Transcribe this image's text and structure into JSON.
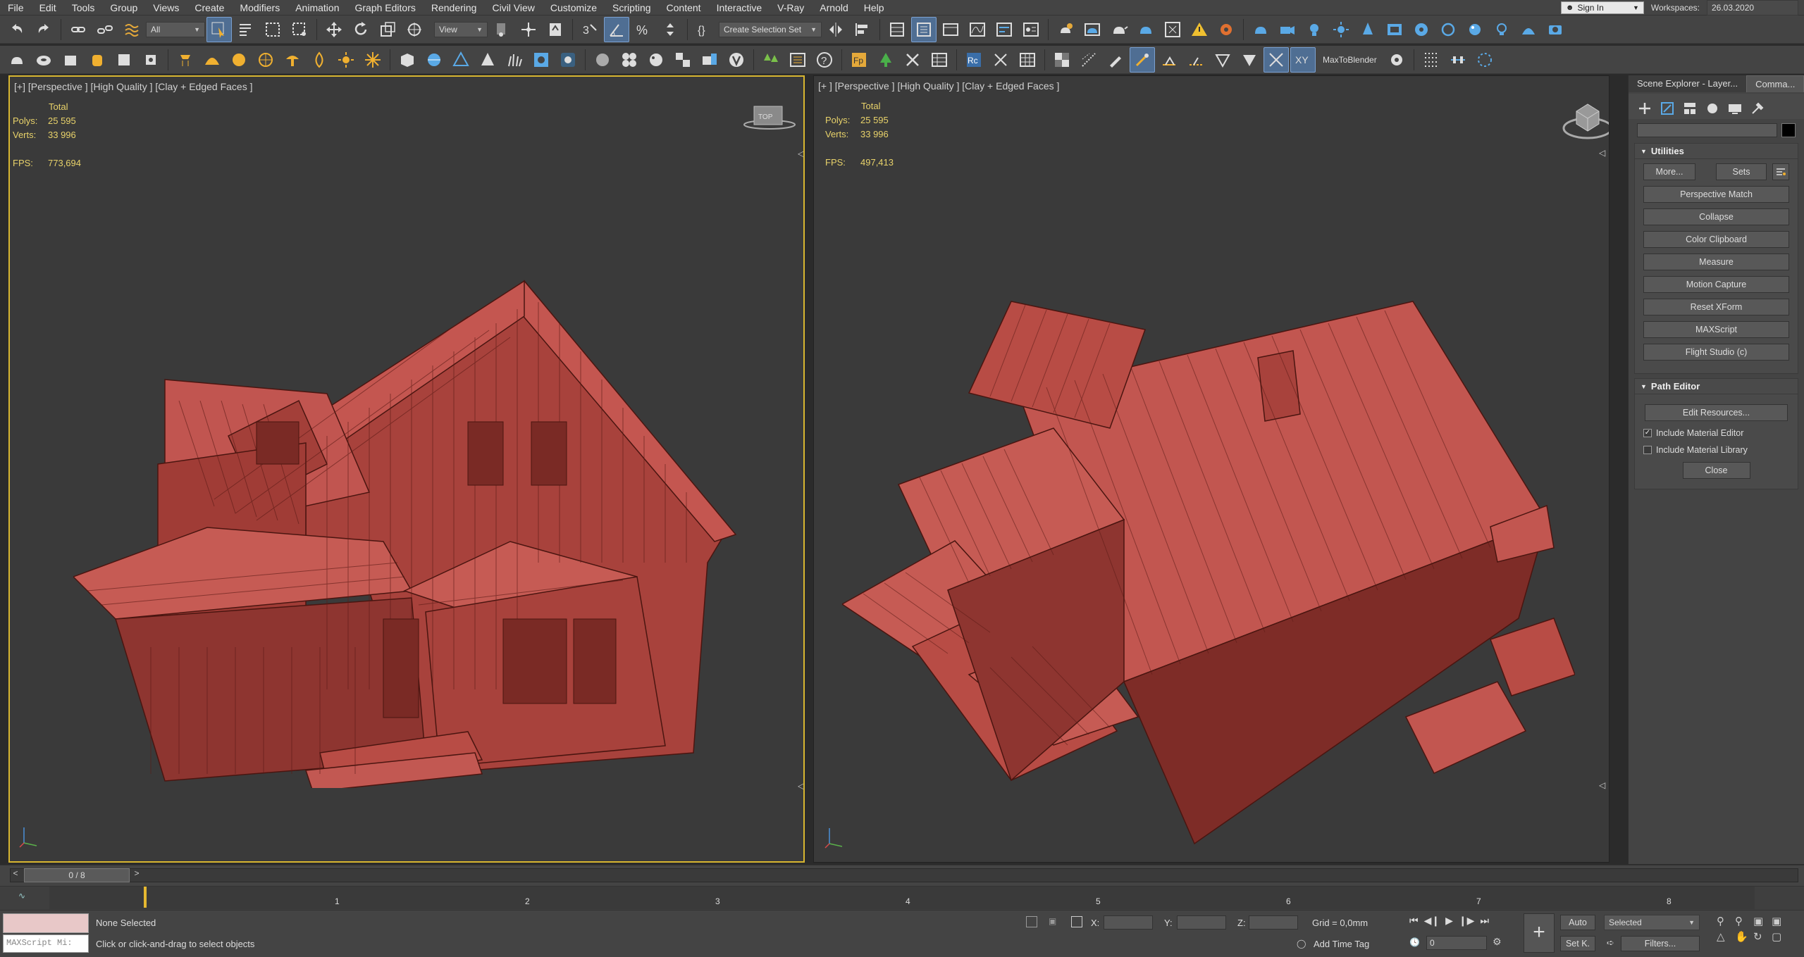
{
  "menu": {
    "items": [
      "File",
      "Edit",
      "Tools",
      "Group",
      "Views",
      "Create",
      "Modifiers",
      "Animation",
      "Graph Editors",
      "Rendering",
      "Civil View",
      "Customize",
      "Scripting",
      "Content",
      "Interactive",
      "V-Ray",
      "Arnold",
      "Help"
    ],
    "sign_in": "Sign In",
    "workspaces_label": "Workspaces:",
    "workspaces_value": "26.03.2020"
  },
  "toolbar": {
    "filter_selected": "All",
    "ref_coord": "View",
    "selection_set": "Create Selection Set",
    "plugin_label": "MaxToBlender"
  },
  "viewports": [
    {
      "label": "[+] [Perspective ] [High Quality ] [Clay + Edged Faces ]",
      "stats": {
        "total": "Total",
        "polys_label": "Polys:",
        "polys": "25 595",
        "verts_label": "Verts:",
        "verts": "33 996",
        "fps_label": "FPS:",
        "fps": "773,694"
      }
    },
    {
      "label": "[+ ] [Perspective ] [High Quality ] [Clay + Edged Faces ]",
      "stats": {
        "total": "Total",
        "polys_label": "Polys:",
        "polys": "25 595",
        "verts_label": "Verts:",
        "verts": "33 996",
        "fps_label": "FPS:",
        "fps": "497,413"
      }
    }
  ],
  "panel": {
    "tabs": [
      "Scene Explorer - Layer...",
      "Comma..."
    ],
    "utilities": {
      "title": "Utilities",
      "more": "More...",
      "sets": "Sets",
      "buttons": [
        "Perspective Match",
        "Collapse",
        "Color Clipboard",
        "Measure",
        "Motion Capture",
        "Reset XForm",
        "MAXScript",
        "Flight Studio (c)"
      ]
    },
    "path_editor": {
      "title": "Path Editor",
      "edit_resources": "Edit Resources...",
      "include_material_editor": "Include Material Editor",
      "include_material_library": "Include Material Library",
      "close": "Close"
    }
  },
  "timeline": {
    "frame_counter": "0 / 8",
    "ticks": [
      "1",
      "2",
      "3",
      "4",
      "5",
      "6",
      "7",
      "8"
    ]
  },
  "status": {
    "maxscript_placeholder": "MAXScript Mi:",
    "selection": "None Selected",
    "prompt": "Click or click-and-drag to select objects",
    "x_label": "X:",
    "y_label": "Y:",
    "z_label": "Z:",
    "grid": "Grid = 0,0mm",
    "add_time_tag": "Add Time Tag",
    "auto": "Auto",
    "set_key": "Set K.",
    "key_mode": "Selected",
    "filters": "Filters...",
    "frame": "0"
  },
  "colors": {
    "clay": "#b64b44",
    "viewport_bg": "#3a3a3a",
    "active_border": "#d8b630",
    "stats": "#e8d26a"
  }
}
